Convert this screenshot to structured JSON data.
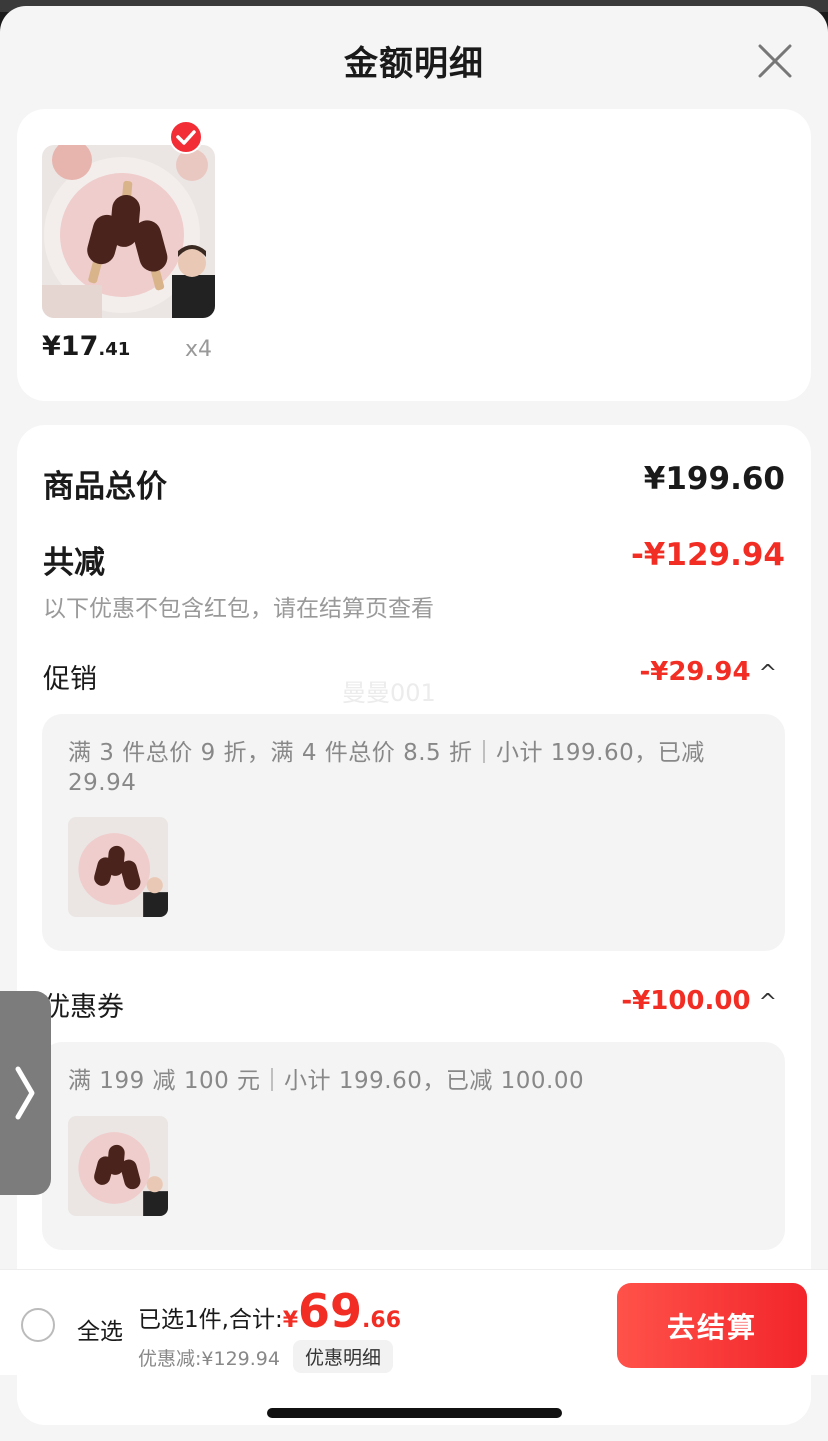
{
  "sheet": {
    "title": "金额明细",
    "close_icon": "close-icon"
  },
  "product": {
    "price_int": "¥17",
    "price_dec": ".41",
    "quantity": "x4",
    "selected": true,
    "check_icon": "checkmark-icon"
  },
  "summary_card": {
    "total_label": "商品总价",
    "total_value": "¥199.60",
    "reduce_label": "共减",
    "reduce_value": "-¥129.94",
    "note": "以下优惠不包含红包，请在结算页查看",
    "watermark": "曼曼001"
  },
  "promotion": {
    "label": "促销",
    "value": "-¥29.94",
    "chevron": "^",
    "detail": "满 3 件总价 9 折，满 4 件总价 8.5 折｜小计 199.60，已减 29.94"
  },
  "coupon": {
    "label": "优惠券",
    "value": "-¥100.00",
    "chevron": "^",
    "detail": "满 199 减 100 元｜小计 199.60，已减 100.00"
  },
  "side_tab": {
    "icon": "chevron-right-icon",
    "glyph": "❯"
  },
  "bottom_bar": {
    "select_all": "全选",
    "selected_text": "已选1件,合计:",
    "currency": "¥",
    "total_int": "69",
    "total_dec": ".66",
    "discount_text": "优惠减:¥129.94",
    "detail_button": "优惠明细",
    "checkout_button": "去结算"
  },
  "colors": {
    "accent_red": "#f22d24",
    "sheet_bg": "#f5f5f5",
    "card_bg": "#ffffff"
  }
}
